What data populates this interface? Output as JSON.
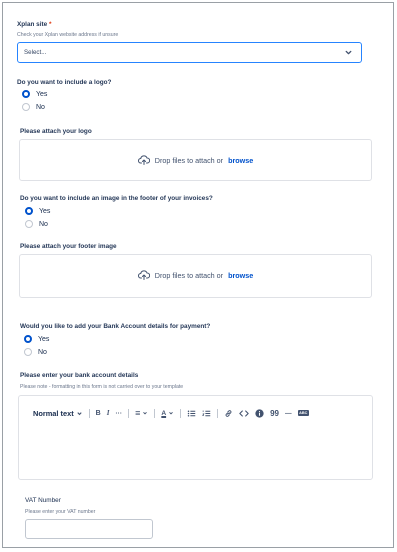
{
  "xplan": {
    "label": "Xplan site",
    "required_mark": "*",
    "help": "Check your Xplan website address if unsure",
    "select_value": "Select..."
  },
  "logo_question": {
    "label": "Do you want to include a logo?",
    "options": [
      {
        "label": "Yes",
        "checked": true
      },
      {
        "label": "No",
        "checked": false
      }
    ]
  },
  "logo_attach": {
    "label": "Please attach your logo",
    "drop_text": "Drop files to attach or",
    "browse": "browse"
  },
  "footer_question": {
    "label": "Do you want to include an image in the footer of your invoices?",
    "options": [
      {
        "label": "Yes",
        "checked": true
      },
      {
        "label": "No",
        "checked": false
      }
    ]
  },
  "footer_attach": {
    "label": "Please attach your footer image",
    "drop_text": "Drop files to attach or",
    "browse": "browse"
  },
  "bank_question": {
    "label": "Would you like to add your Bank Account details for payment?",
    "options": [
      {
        "label": "Yes",
        "checked": true
      },
      {
        "label": "No",
        "checked": false
      }
    ]
  },
  "bank_details": {
    "label": "Please enter your bank account details",
    "help": "Please note - formatting in this form is not carried over to your template"
  },
  "editor": {
    "text_style": "Normal text",
    "bold": "B",
    "italic": "I",
    "more": "···",
    "align": "≡",
    "color": "A",
    "quote": "99",
    "rule": "—",
    "abc": "ABC"
  },
  "vat": {
    "label": "VAT Number",
    "help": "Please enter your VAT number",
    "value": ""
  },
  "colors": {
    "accent": "#0052cc",
    "focus_border": "#2684ff",
    "required": "#de350b"
  }
}
